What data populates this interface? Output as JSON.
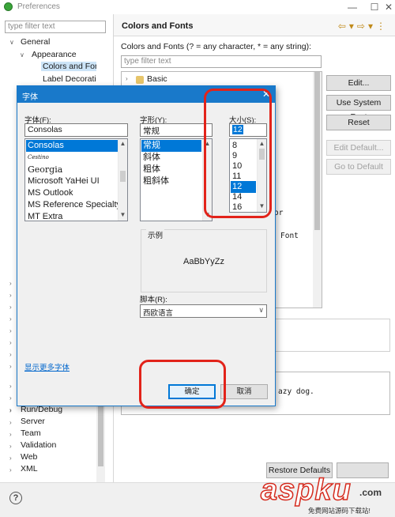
{
  "window": {
    "title": "Preferences"
  },
  "sidebar": {
    "filter_placeholder": "type filter text",
    "items": [
      {
        "label": "General"
      },
      {
        "label": "Appearance"
      },
      {
        "label": "Colors and Fonts"
      },
      {
        "label": "Label Decorations"
      },
      {
        "label": "Run/Debug"
      },
      {
        "label": "Server"
      },
      {
        "label": "Team"
      },
      {
        "label": "Validation"
      },
      {
        "label": "Web"
      },
      {
        "label": "XML"
      }
    ]
  },
  "page": {
    "title": "Colors and Fonts",
    "filter_label": "Colors and Fonts (? = any character, * = any string):",
    "filter_placeholder": "type filter text",
    "tree_root": "Basic",
    "visible_text_1": "or",
    "visible_text_2": "Font",
    "preview_text": "azy dog.",
    "buttons": {
      "edit": "Edit...",
      "use_system_font": "Use System Font",
      "reset": "Reset",
      "edit_default": "Edit Default...",
      "go_to_default": "Go to Default",
      "restore_defaults": "Restore Defaults"
    }
  },
  "font_dialog": {
    "title": "字体",
    "font_label": "字体(F):",
    "font_value": "Consolas",
    "fonts": [
      "Consolas",
      "Cestino",
      "Georgia",
      "Microsoft YaHei UI",
      "MS Outlook",
      "MS Reference Specialty",
      "MT Extra"
    ],
    "style_label": "字形(Y):",
    "style_value": "常规",
    "styles": [
      "常规",
      "斜体",
      "粗体",
      "粗斜体"
    ],
    "size_label": "大小(S):",
    "size_value": "12",
    "sizes": [
      "8",
      "9",
      "10",
      "11",
      "12",
      "14",
      "16"
    ],
    "sample_label": "示例",
    "sample_text": "AaBbYyZz",
    "script_label": "脚本(R):",
    "script_value": "西欧语言",
    "more_fonts_link": "显示更多字体",
    "ok": "确定",
    "cancel": "取消"
  },
  "watermark": {
    "brand": "aspku",
    "suffix": ".com",
    "tagline": "免费网站源码下载站!"
  },
  "colors": {
    "accent": "#1979ca",
    "highlight": "#e2231a",
    "selection": "#0078d7"
  }
}
